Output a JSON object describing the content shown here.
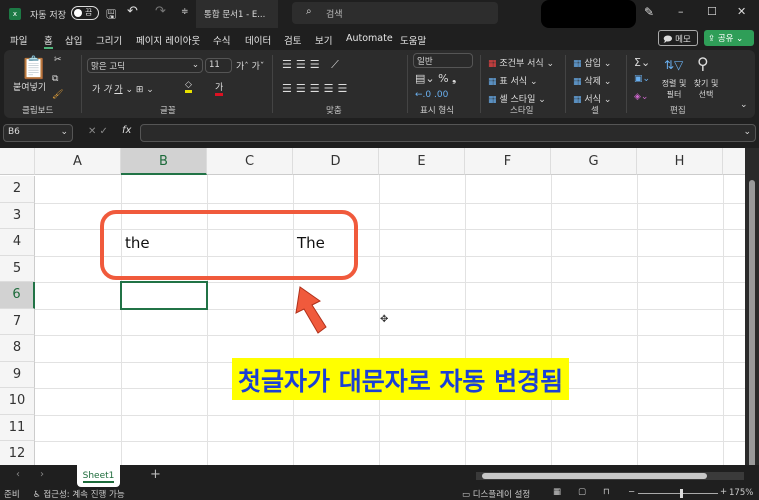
{
  "titlebar": {
    "autosave": "자동 저장",
    "toggle": "끔",
    "doc_title": "통합 문서1 - E...",
    "search": "검색"
  },
  "menu": [
    "파일",
    "홈",
    "삽입",
    "그리기",
    "페이지 레이아웃",
    "수식",
    "데이터",
    "검토",
    "보기",
    "Automate",
    "도움말"
  ],
  "memo": "메모",
  "share": "공유",
  "ribbon": {
    "paste": "붙여넣기",
    "clipboard": "클립보드",
    "font_name": "맑은 고딕",
    "font_size": "11",
    "font": "글꼴",
    "align": "맞춤",
    "number_format": "일반",
    "number": "표시 형식",
    "cond": "조건부 서식",
    "table": "표 서식",
    "cellstyle": "셀 스타일",
    "styles": "스타일",
    "insert": "삽입",
    "delete": "삭제",
    "format": "서식",
    "cells": "셀",
    "sort": "정렬 및 필터",
    "find": "찾기 및 선택",
    "editing": "편집"
  },
  "formula": {
    "namebox": "B6",
    "fx": "fx",
    "value": ""
  },
  "columns": [
    "A",
    "B",
    "C",
    "D",
    "E",
    "F",
    "G",
    "H"
  ],
  "rows": [
    "2",
    "3",
    "4",
    "5",
    "6",
    "7",
    "8",
    "9",
    "10",
    "11",
    "12"
  ],
  "cells": {
    "B4": "the",
    "D4": "The"
  },
  "annotation": "첫글자가 대문자로 자동 변경됨",
  "sheet_tab": "Sheet1",
  "status": {
    "ready": "준비",
    "accessibility": "접근성: 계속 진행 가능",
    "display": "디스플레이 설정",
    "zoom": "175%"
  },
  "colors": {
    "accent": "#217346",
    "annotation_border": "#f05a3c",
    "annotation_bg": "#ffff00",
    "annotation_text": "#1a3fd6"
  }
}
